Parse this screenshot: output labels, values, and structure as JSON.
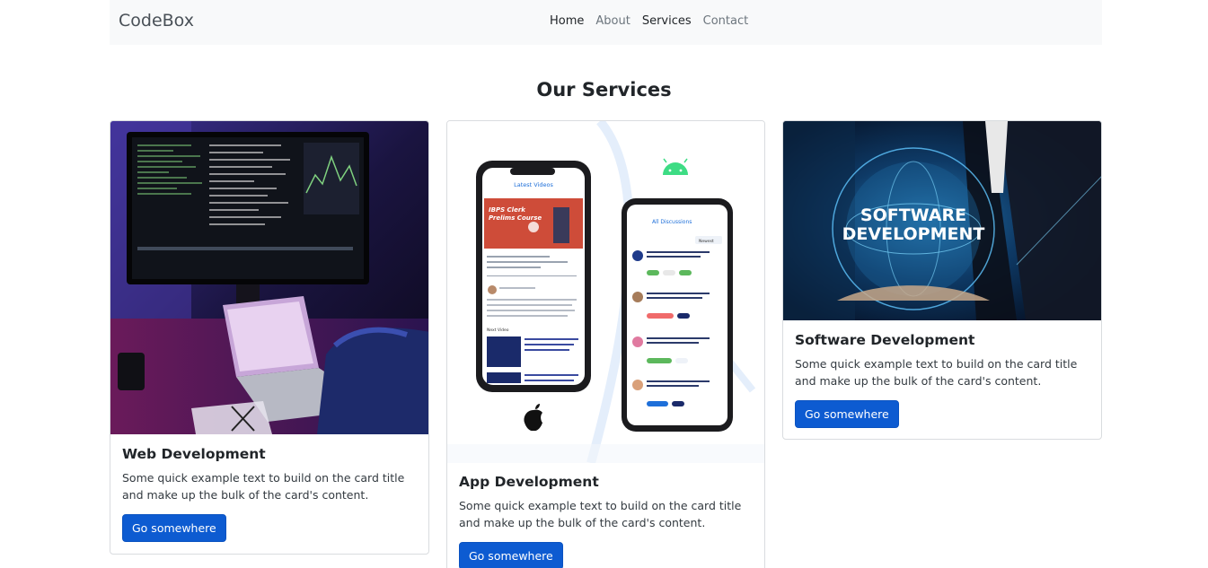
{
  "navbar": {
    "brand": "CodeBox",
    "links": [
      {
        "label": "Home",
        "active": true
      },
      {
        "label": "About",
        "active": false
      },
      {
        "label": "Services",
        "active": true
      },
      {
        "label": "Contact",
        "active": false
      }
    ]
  },
  "section": {
    "title": "Our Services"
  },
  "cards": [
    {
      "image": "person-coding-at-monitor-image",
      "title": "Web Development",
      "text": "Some quick example text to build on the card title and make up the bulk of the card's content.",
      "button": "Go somewhere"
    },
    {
      "image": "phone-app-mockups-image",
      "title": "App Development",
      "text": "Some quick example text to build on the card title and make up the bulk of the card's content.",
      "button": "Go somewhere",
      "mockup": {
        "left_screen": {
          "header": "Latest Videos",
          "banner_line1": "IBPS Clerk",
          "banner_line2": "Prelims Course",
          "section": "Next Video"
        },
        "right_screen": {
          "header": "All Discussions",
          "filter": "Newest"
        }
      }
    },
    {
      "image": "software-development-globe-image",
      "title": "Software Development",
      "text": "Some quick example text to build on the card title and make up the bulk of the card's content.",
      "button": "Go somewhere",
      "image_text_line1": "SOFTWARE",
      "image_text_line2": "DEVELOPMENT"
    }
  ],
  "colors": {
    "navbar_bg": "#f8f9fa",
    "primary": "#0d5bd1"
  }
}
